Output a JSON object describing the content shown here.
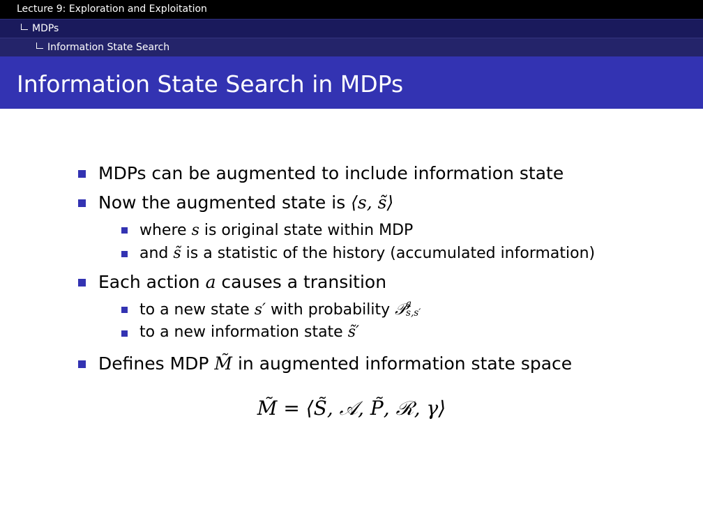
{
  "breadcrumb": {
    "lecture": "Lecture 9: Exploration and Exploitation",
    "section": "MDPs",
    "subsection": "Information State Search"
  },
  "slide": {
    "title": "Information State Search in MDPs"
  },
  "bullets": {
    "b1": "MDPs can be augmented to include information state",
    "b2_text": "Now the augmented state is ",
    "b2_math": "⟨s, s̃⟩",
    "b2_sub1_pre": "where ",
    "b2_sub1_var": "s",
    "b2_sub1_post": " is original state within MDP",
    "b2_sub2_pre": "and ",
    "b2_sub2_var": "s̃",
    "b2_sub2_post": " is a statistic of the history (accumulated information)",
    "b3_pre": "Each action ",
    "b3_var": "a",
    "b3_post": " causes a transition",
    "b3_sub1_pre": "to a new state ",
    "b3_sub1_var": "s′",
    "b3_sub1_mid": " with probability ",
    "b3_sub1_P": "𝒫",
    "b3_sub1_sup": "a",
    "b3_sub1_sub": "s,s′",
    "b3_sub2_pre": "to a new information state ",
    "b3_sub2_var": "s̃′",
    "b4_pre": "Defines MDP ",
    "b4_var": "M̃",
    "b4_post": " in augmented information state space"
  },
  "equation": "M̃ = ⟨S̃, 𝒜, P̃, ℛ, γ⟩",
  "colors": {
    "title_bar": "#3333b2",
    "bullet": "#3333b2",
    "breadcrumb_top": "#000000",
    "breadcrumb_mid": "#1a1a5c",
    "breadcrumb_low": "#24246a"
  }
}
